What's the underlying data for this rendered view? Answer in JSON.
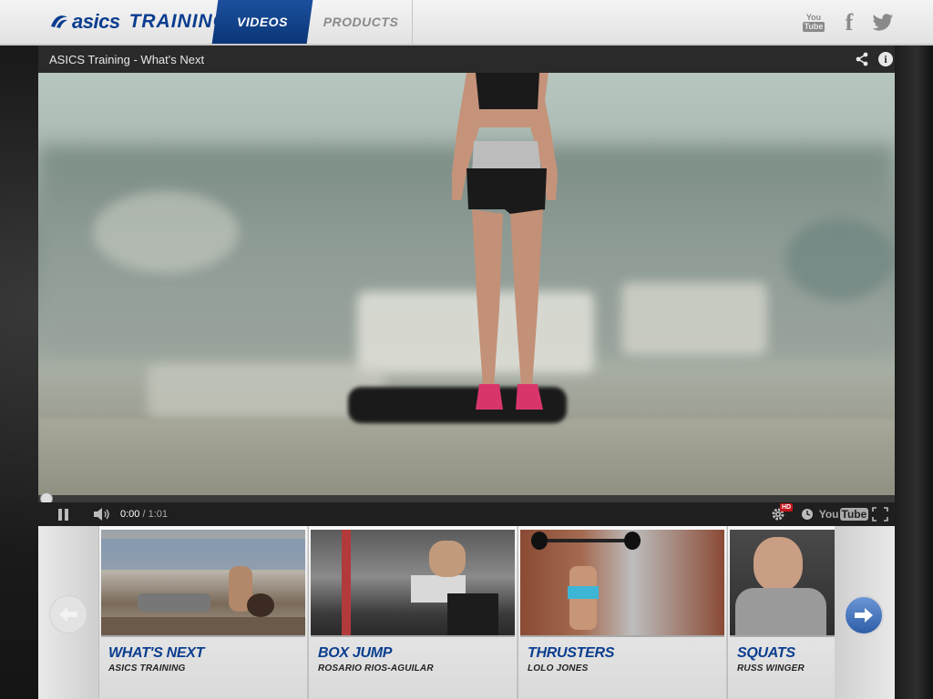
{
  "header": {
    "logo_brand": "asics",
    "logo_product": "TRAINING",
    "nav": [
      {
        "label": "VIDEOS",
        "active": true
      },
      {
        "label": "PRODUCTS",
        "active": false
      }
    ],
    "social": {
      "youtube_top": "You",
      "youtube_bottom": "Tube",
      "facebook": "f",
      "twitter_icon": "twitter-bird-icon"
    }
  },
  "player": {
    "title": "ASICS Training - What's Next",
    "current_time": "0:00",
    "duration": "/ 1:01",
    "progress": 0.0,
    "hd_label": "HD",
    "youtube_label": "You",
    "youtube_label_box": "Tube"
  },
  "carousel": {
    "items": [
      {
        "title": "WHAT'S NEXT",
        "subtitle": "ASICS TRAINING"
      },
      {
        "title": "BOX JUMP",
        "subtitle": "ROSARIO RIOS-AGUILAR"
      },
      {
        "title": "THRUSTERS",
        "subtitle": "LOLO JONES"
      },
      {
        "title": "SQUATS",
        "subtitle": "RUSS WINGER"
      }
    ]
  },
  "colors": {
    "brand_blue": "#0a3d8f",
    "nav_active": "#1c4f9e",
    "hd_red": "#c4161c"
  }
}
